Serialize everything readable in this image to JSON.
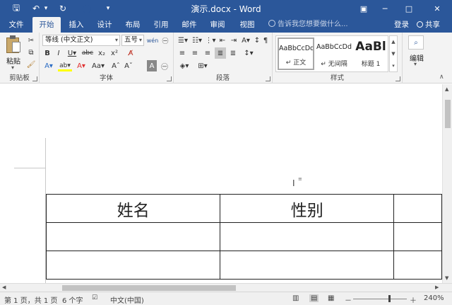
{
  "titlebar": {
    "title": "演示.docx - Word",
    "qa": [
      {
        "name": "save-icon",
        "glyph": "🖫"
      },
      {
        "name": "undo-icon",
        "glyph": "↶"
      },
      {
        "name": "undo-dropdown-icon",
        "glyph": "▾"
      },
      {
        "name": "redo-icon",
        "glyph": "↻"
      },
      {
        "name": "touch-mode-icon",
        "glyph": "◯"
      },
      {
        "name": "customize-qat-icon",
        "glyph": "▾"
      }
    ],
    "window_buttons": [
      {
        "name": "ribbon-display-options-icon",
        "glyph": "▣"
      },
      {
        "name": "minimize-icon",
        "glyph": "─"
      },
      {
        "name": "maximize-icon",
        "glyph": "□"
      },
      {
        "name": "close-icon",
        "glyph": "✕"
      }
    ]
  },
  "tabs": [
    {
      "label": "文件",
      "active": false
    },
    {
      "label": "开始",
      "active": true
    },
    {
      "label": "插入",
      "active": false
    },
    {
      "label": "设计",
      "active": false
    },
    {
      "label": "布局",
      "active": false
    },
    {
      "label": "引用",
      "active": false
    },
    {
      "label": "邮件",
      "active": false
    },
    {
      "label": "审阅",
      "active": false
    },
    {
      "label": "视图",
      "active": false
    }
  ],
  "tellme": "告诉我您想要做什么...",
  "login": "登录",
  "share": "共享",
  "ribbon": {
    "clipboard": {
      "paste": "粘贴",
      "label": "剪贴板"
    },
    "font": {
      "name": "等线 (中文正文)",
      "size": "五号",
      "label": "字体",
      "wen": "wén",
      "buttons1": [
        {
          "name": "grow-font-button",
          "glyph": "A^"
        },
        {
          "name": "shrink-font-button",
          "glyph": "Aˇ"
        },
        {
          "name": "change-case-button",
          "glyph": "Aa▾"
        },
        {
          "name": "clear-formatting-button",
          "glyph": "A̸"
        },
        {
          "name": "phonetic-guide-button",
          "glyph": "wén"
        }
      ],
      "buttons2": [
        {
          "name": "bold-button",
          "glyph": "B"
        },
        {
          "name": "italic-button",
          "glyph": "I"
        },
        {
          "name": "underline-button",
          "glyph": "U▾"
        },
        {
          "name": "strikethrough-button",
          "glyph": "abc"
        },
        {
          "name": "subscript-button",
          "glyph": "x₂"
        },
        {
          "name": "superscript-button",
          "glyph": "x²"
        }
      ],
      "buttons3": [
        {
          "name": "text-effects-button",
          "glyph": "A▾"
        },
        {
          "name": "highlight-button",
          "glyph": "ab▾"
        },
        {
          "name": "font-color-button",
          "glyph": "A▾"
        },
        {
          "name": "change-case-aa-button",
          "glyph": "Aa▾"
        },
        {
          "name": "enlarge-a-button",
          "glyph": "Aˆ"
        },
        {
          "name": "shrink-a-button",
          "glyph": "Aˇ"
        },
        {
          "name": "char-shading-button",
          "glyph": "A"
        },
        {
          "name": "enclose-char-button",
          "glyph": "㊀"
        }
      ],
      "colors": {
        "highlight": "#ffff00",
        "font": "#e03030",
        "effects": "#2b6cc4"
      }
    },
    "paragraph": {
      "label": "段落",
      "row1": [
        {
          "name": "bullets-button",
          "glyph": "☰▾"
        },
        {
          "name": "numbering-button",
          "glyph": "☷▾"
        },
        {
          "name": "multilevel-list-button",
          "glyph": "⋮▾"
        },
        {
          "name": "decrease-indent-button",
          "glyph": "⇤"
        },
        {
          "name": "increase-indent-button",
          "glyph": "⇥"
        },
        {
          "name": "chinese-layout-button",
          "glyph": "A▾"
        },
        {
          "name": "sort-button",
          "glyph": "↕"
        },
        {
          "name": "show-marks-button",
          "glyph": "¶"
        }
      ],
      "row2": [
        {
          "name": "align-left-button",
          "glyph": "≡"
        },
        {
          "name": "align-center-button",
          "glyph": "≡"
        },
        {
          "name": "align-right-button",
          "glyph": "≡"
        },
        {
          "name": "justify-button",
          "glyph": "≣"
        },
        {
          "name": "distributed-button",
          "glyph": "≣"
        },
        {
          "name": "line-spacing-button",
          "glyph": "↕▾"
        }
      ],
      "row3": [
        {
          "name": "shading-button",
          "glyph": "◈▾"
        },
        {
          "name": "borders-button",
          "glyph": "⊞▾"
        }
      ]
    },
    "styles": {
      "label": "样式",
      "items": [
        {
          "preview": "AaBbCcDd",
          "name": "↵ 正文",
          "selected": true,
          "big": false
        },
        {
          "preview": "AaBbCcDd",
          "name": "↵ 无间隔",
          "selected": false,
          "big": false
        },
        {
          "preview": "AaBl",
          "name": "标题 1",
          "selected": false,
          "big": true
        }
      ]
    },
    "editing": {
      "label": "编辑"
    }
  },
  "table": {
    "header": [
      "姓名",
      "性别",
      ""
    ],
    "empty_rows": 2
  },
  "status": {
    "page": "第 1 页，共 1 页",
    "words": "6 个字",
    "lang": "中文(中国)",
    "zoom": "240%",
    "zoom_minus": "－",
    "zoom_plus": "＋"
  }
}
